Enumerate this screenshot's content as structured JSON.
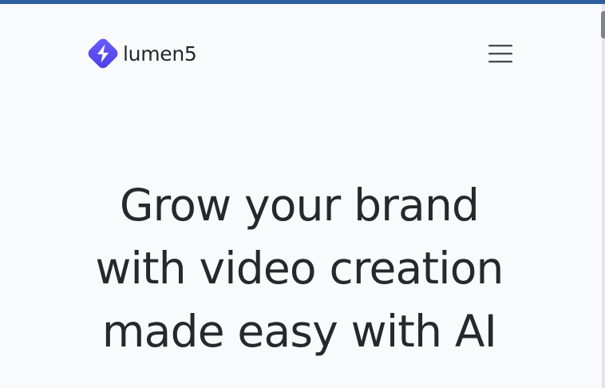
{
  "brand": {
    "name": "lumen5",
    "logo_icon": "lumen5-logo-icon",
    "accent_color": "#5a4ff3"
  },
  "header": {
    "menu_icon": "hamburger-menu-icon"
  },
  "hero": {
    "lines": [
      "Grow your brand",
      "with video creation",
      "made easy with AI"
    ]
  }
}
